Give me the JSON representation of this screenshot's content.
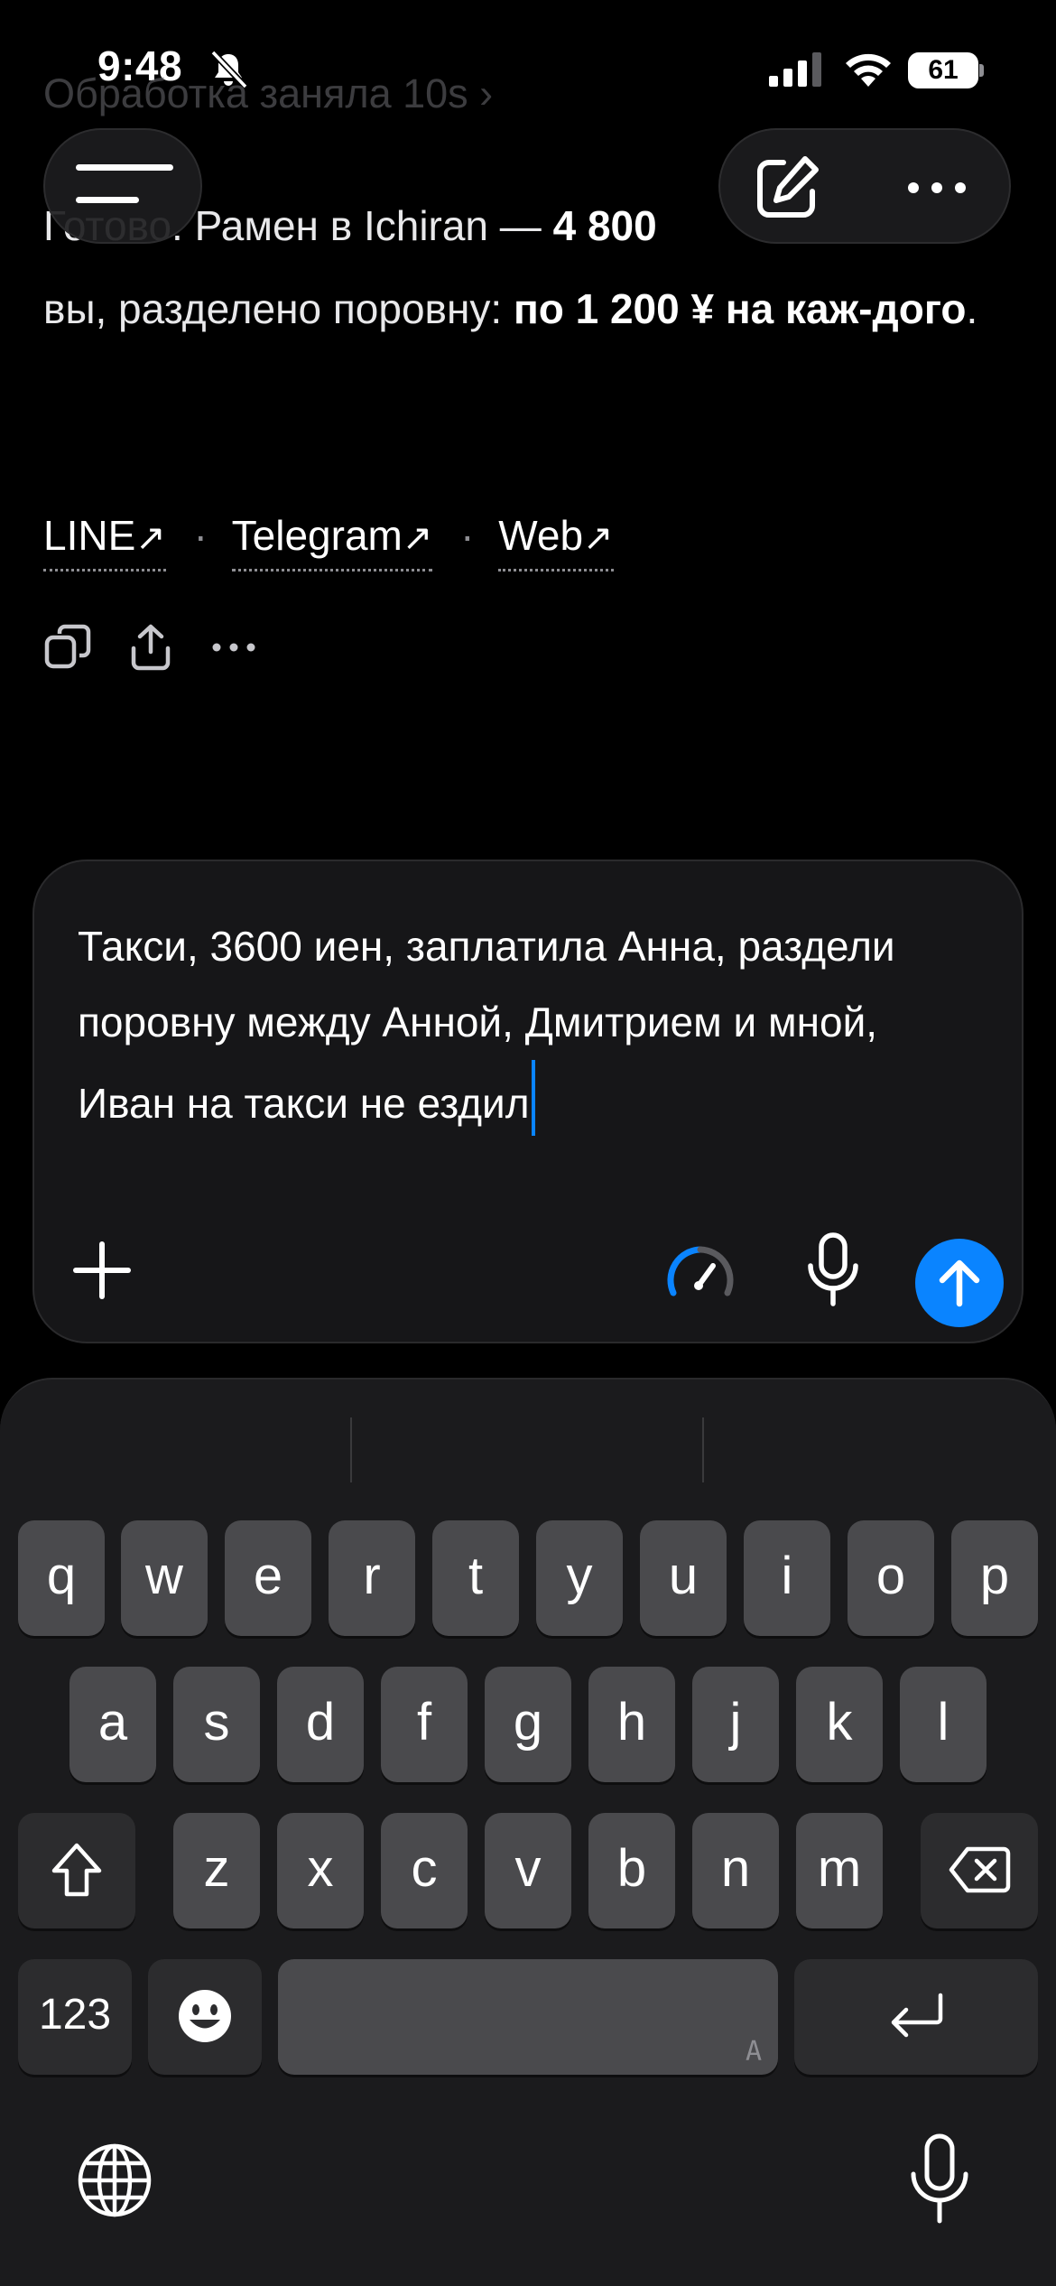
{
  "status_bar": {
    "time": "9:48",
    "battery_level": "61",
    "icons": [
      "bell-slash-icon",
      "signal-icon",
      "wifi-icon",
      "battery-icon"
    ]
  },
  "thread": {
    "processing_line": "Обработка заняла 10s  ›",
    "answer_prefix": "Готово. Рамен в Ichiran — ",
    "answer_amount": "4 800",
    "answer_middle": "вы, разделено поровну: ",
    "answer_share": "по 1 200 ¥ на каж-дого",
    "answer_end": ".",
    "links": [
      {
        "label": "LINE",
        "arrow": "↗"
      },
      {
        "label": "Telegram",
        "arrow": "↗"
      },
      {
        "label": "Web",
        "arrow": "↗"
      }
    ],
    "separator": "·",
    "action_icons": [
      "copy-icon",
      "share-icon",
      "more-icon"
    ]
  },
  "composer": {
    "text": "Такси, 3600 иен, заплатила Анна, раздели поровну между Анной, Дмитрием и мной, Иван на такси не ездил",
    "accent": "#0a84ff"
  },
  "keyboard": {
    "row1": [
      "q",
      "w",
      "e",
      "r",
      "t",
      "y",
      "u",
      "i",
      "o",
      "p"
    ],
    "row2": [
      "a",
      "s",
      "d",
      "f",
      "g",
      "h",
      "j",
      "k",
      "l"
    ],
    "row3": [
      "z",
      "x",
      "c",
      "v",
      "b",
      "n",
      "m"
    ],
    "numbers_label": "123",
    "space_hint": "A"
  }
}
